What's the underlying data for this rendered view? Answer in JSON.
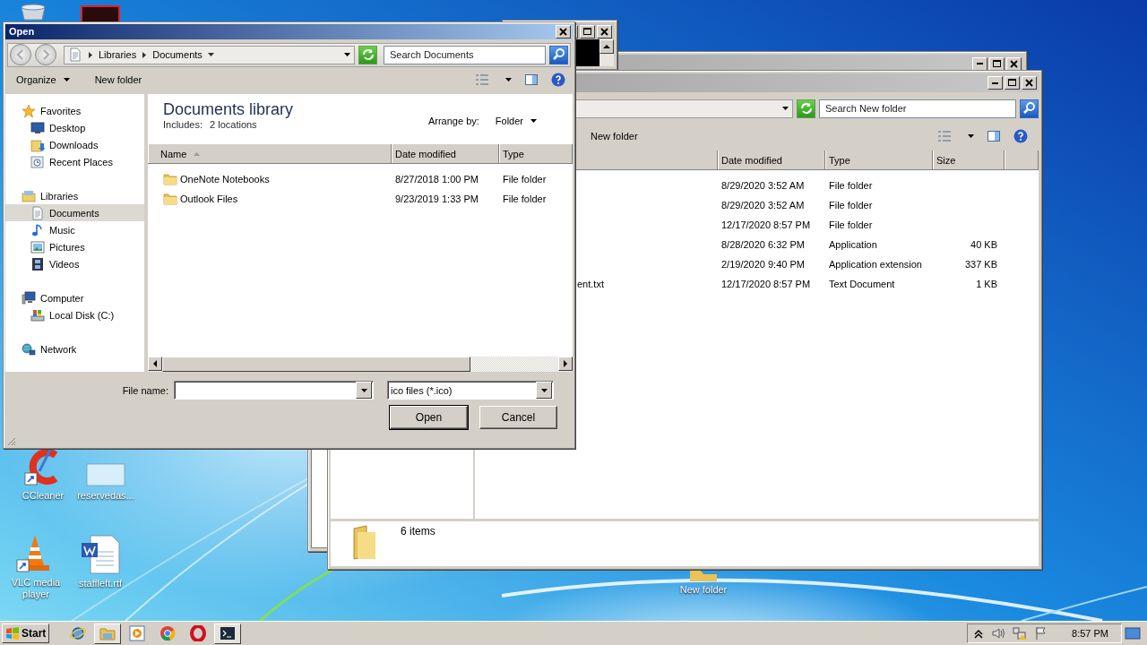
{
  "desktop": {
    "icons": [
      {
        "kind": "recycle-bin"
      },
      {
        "kind": "app-tile"
      },
      {
        "kind": "ccleaner",
        "label": "CCleaner"
      },
      {
        "kind": "blank-file",
        "label": "reservedas..."
      },
      {
        "kind": "vlc",
        "label": "VLC media player"
      },
      {
        "kind": "word-doc",
        "label": "staffleft.rtf"
      },
      {
        "kind": "folder",
        "label": "New folder"
      }
    ]
  },
  "explorer_window": {
    "search": {
      "placeholder": "Search New folder"
    },
    "toolbar": [
      "New folder"
    ],
    "columns": [
      "Date modified",
      "Type",
      "Size"
    ],
    "rows": [
      {
        "date": "8/29/2020 3:52 AM",
        "type": "File folder"
      },
      {
        "date": "8/29/2020 3:52 AM",
        "type": "File folder"
      },
      {
        "date": "12/17/2020 8:57 PM",
        "type": "File folder"
      },
      {
        "date": "8/28/2020 6:32 PM",
        "type": "Application",
        "size": "40 KB"
      },
      {
        "date": "2/19/2020 9:40 PM",
        "type": "Application extension",
        "size": "337 KB"
      },
      {
        "name": "ent.txt",
        "date": "12/17/2020 8:57 PM",
        "type": "Text Document",
        "size": "1 KB"
      }
    ],
    "status": "6 items"
  },
  "open_dialog": {
    "title": "Open",
    "breadcrumb": [
      "Libraries",
      "Documents"
    ],
    "search": {
      "placeholder": "Search Documents"
    },
    "toolbar": [
      "Organize",
      "New folder"
    ],
    "nav": [
      {
        "label": "Favorites",
        "kind": "star",
        "selected": false,
        "children": [
          {
            "label": "Desktop",
            "kind": "desktop",
            "selected": false
          },
          {
            "label": "Downloads",
            "kind": "downloads",
            "selected": false
          },
          {
            "label": "Recent Places",
            "kind": "recent",
            "selected": false
          }
        ]
      },
      {
        "label": "Libraries",
        "kind": "libraries",
        "selected": false,
        "children": [
          {
            "label": "Documents",
            "kind": "documents",
            "selected": true
          },
          {
            "label": "Music",
            "kind": "music",
            "selected": false
          },
          {
            "label": "Pictures",
            "kind": "pictures",
            "selected": false
          },
          {
            "label": "Videos",
            "kind": "videos",
            "selected": false
          }
        ]
      },
      {
        "label": "Computer",
        "kind": "computer",
        "selected": false,
        "children": [
          {
            "label": "Local Disk (C:)",
            "kind": "disk",
            "selected": false
          }
        ]
      },
      {
        "label": "Network",
        "kind": "network",
        "selected": false
      }
    ],
    "library": {
      "title": "Documents library",
      "includes_label": "Includes:",
      "includes_value": "2 locations",
      "arrange_label": "Arrange by:",
      "arrange_value": "Folder"
    },
    "columns": [
      {
        "label": "Name",
        "sorted": true
      },
      {
        "label": "Date modified",
        "sorted": false
      },
      {
        "label": "Type",
        "sorted": false
      }
    ],
    "rows": [
      {
        "name": "OneNote Notebooks",
        "date": "8/27/2018 1:00 PM",
        "type": "File folder"
      },
      {
        "name": "Outlook Files",
        "date": "9/23/2019 1:33 PM",
        "type": "File folder"
      }
    ],
    "file_name": {
      "label": "File name:"
    },
    "file_type": {
      "value": "ico files (*.ico)"
    },
    "buttons": [
      {
        "label": "Open",
        "default": true
      },
      {
        "label": "Cancel",
        "default": false
      }
    ]
  },
  "taskbar": {
    "start": "Start",
    "apps": [
      {
        "kind": "ie",
        "active": false
      },
      {
        "kind": "explorer",
        "active": true
      },
      {
        "kind": "media",
        "active": false
      },
      {
        "kind": "chrome",
        "active": false
      },
      {
        "kind": "opera",
        "active": false
      },
      {
        "kind": "console",
        "active": true
      }
    ],
    "clock": "8:57 PM"
  }
}
